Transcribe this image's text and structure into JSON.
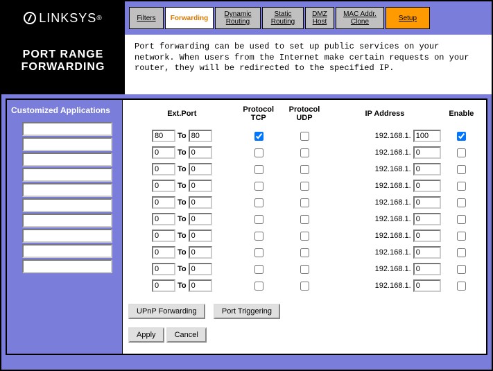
{
  "logo": "LINKSYS",
  "tabs": {
    "filters": "Filters",
    "forwarding": "Forwarding",
    "dynamic_routing": "Dynamic\nRouting",
    "static_routing": "Static\nRouting",
    "dmz_host": "DMZ\nHost",
    "mac_clone": "MAC Addr.\nClone",
    "setup": "Setup"
  },
  "page_title": "PORT RANGE FORWARDING",
  "description": "Port forwarding can be used to set up public services on your network. When users from the Internet make certain requests on your router, they will be redirected to the specified IP.",
  "left_header": "Customized Applications",
  "columns": {
    "ext_port": "Ext.Port",
    "tcp": "Protocol TCP",
    "udp": "Protocol UDP",
    "ip": "IP Address",
    "enable": "Enable"
  },
  "to_label": "To",
  "ip_prefix": "192.168.1.",
  "rows": [
    {
      "app": "",
      "from": "80",
      "to": "80",
      "tcp": true,
      "udp": false,
      "ip": "100",
      "enable": true
    },
    {
      "app": "",
      "from": "0",
      "to": "0",
      "tcp": false,
      "udp": false,
      "ip": "0",
      "enable": false
    },
    {
      "app": "",
      "from": "0",
      "to": "0",
      "tcp": false,
      "udp": false,
      "ip": "0",
      "enable": false
    },
    {
      "app": "",
      "from": "0",
      "to": "0",
      "tcp": false,
      "udp": false,
      "ip": "0",
      "enable": false
    },
    {
      "app": "",
      "from": "0",
      "to": "0",
      "tcp": false,
      "udp": false,
      "ip": "0",
      "enable": false
    },
    {
      "app": "",
      "from": "0",
      "to": "0",
      "tcp": false,
      "udp": false,
      "ip": "0",
      "enable": false
    },
    {
      "app": "",
      "from": "0",
      "to": "0",
      "tcp": false,
      "udp": false,
      "ip": "0",
      "enable": false
    },
    {
      "app": "",
      "from": "0",
      "to": "0",
      "tcp": false,
      "udp": false,
      "ip": "0",
      "enable": false
    },
    {
      "app": "",
      "from": "0",
      "to": "0",
      "tcp": false,
      "udp": false,
      "ip": "0",
      "enable": false
    },
    {
      "app": "",
      "from": "0",
      "to": "0",
      "tcp": false,
      "udp": false,
      "ip": "0",
      "enable": false
    }
  ],
  "buttons": {
    "upnp": "UPnP Forwarding",
    "port_trig": "Port Triggering",
    "apply": "Apply",
    "cancel": "Cancel"
  }
}
